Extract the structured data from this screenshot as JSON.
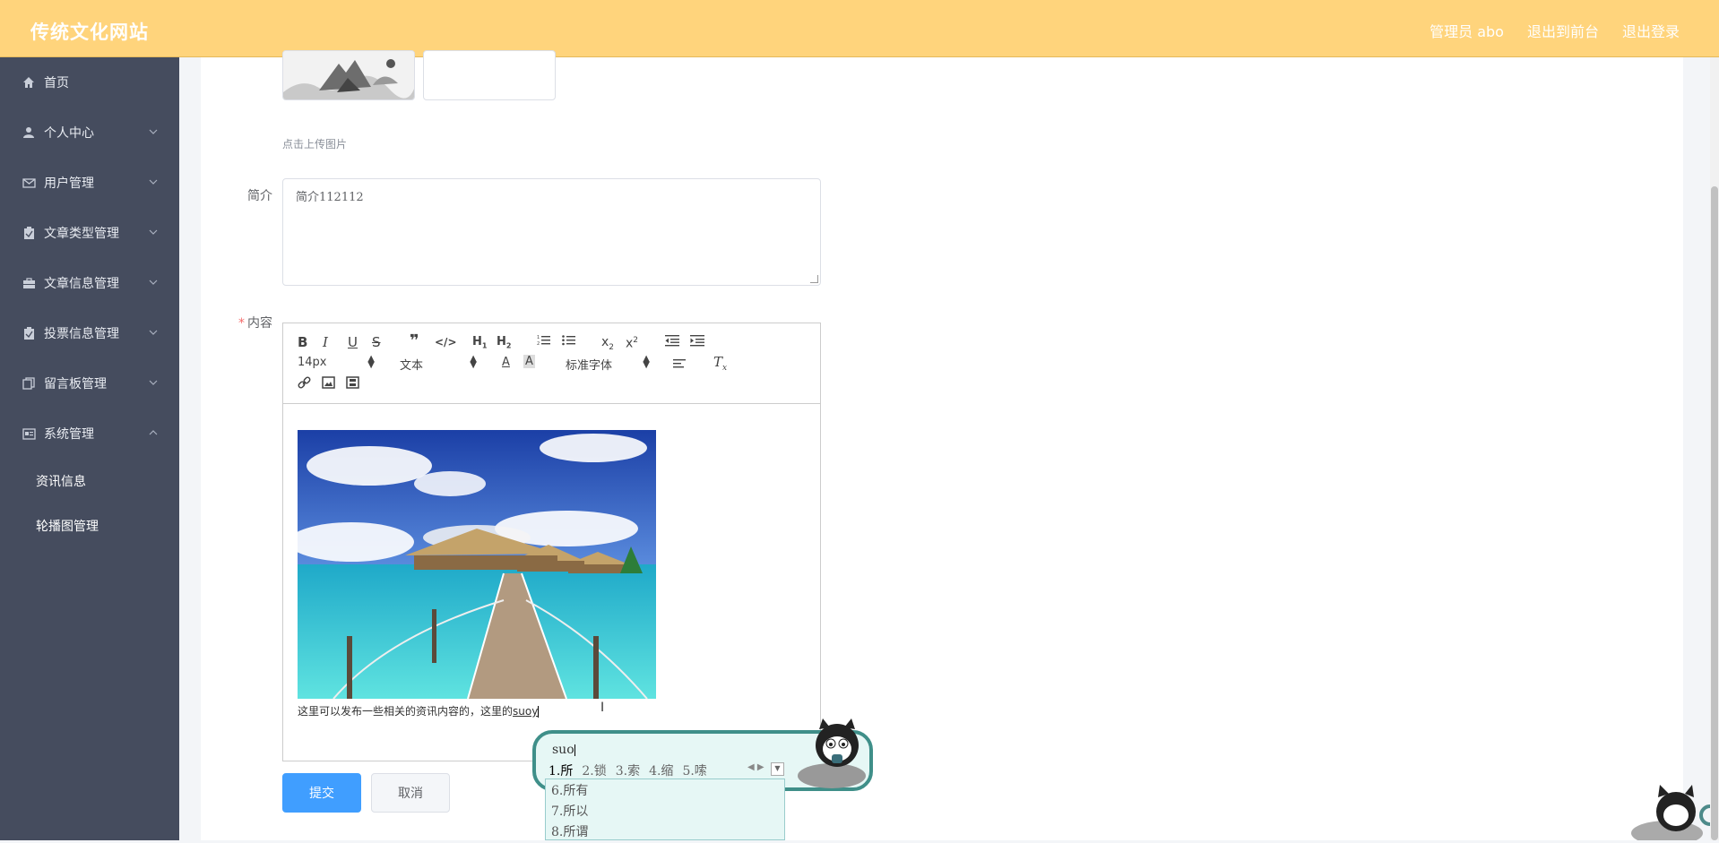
{
  "header": {
    "site_title": "传统文化网站",
    "admin_label": "管理员 abo",
    "to_front_label": "退出到前台",
    "logout_label": "退出登录"
  },
  "sidebar": {
    "items": [
      {
        "label": "首页",
        "icon": "home-icon",
        "expandable": false
      },
      {
        "label": "个人中心",
        "icon": "user-icon",
        "expandable": true
      },
      {
        "label": "用户管理",
        "icon": "mail-icon",
        "expandable": true
      },
      {
        "label": "文章类型管理",
        "icon": "clipboard-icon",
        "expandable": true
      },
      {
        "label": "文章信息管理",
        "icon": "briefcase-icon",
        "expandable": true
      },
      {
        "label": "投票信息管理",
        "icon": "clipboard-check-icon",
        "expandable": true
      },
      {
        "label": "留言板管理",
        "icon": "copy-icon",
        "expandable": true
      },
      {
        "label": "系统管理",
        "icon": "id-card-icon",
        "expandable": true,
        "expanded": true
      }
    ],
    "sub_items": [
      "资讯信息",
      "轮播图管理"
    ]
  },
  "form": {
    "upload_hint": "点击上传图片",
    "intro_label": "简介",
    "intro_value": "简介112112",
    "content_label": "内容",
    "content_required_mark": "*",
    "submit_label": "提交",
    "cancel_label": "取消"
  },
  "editor": {
    "font_size": "14px",
    "block_type": "文本",
    "font_family": "标准字体",
    "content_text": "这里可以发布一些相关的资讯内容的，这里的",
    "typed_text": "suoy"
  },
  "ime": {
    "composition": "suo",
    "candidates": [
      "1.所",
      "2.锁",
      "3.索",
      "4.缩",
      "5.嗦"
    ],
    "expanded": [
      "6.所有",
      "7.所以",
      "8.所谓"
    ]
  },
  "colors": {
    "header_bg": "#ffd47c",
    "sidebar_bg": "#454c5e",
    "primary": "#409eff",
    "required": "#f56c6c",
    "ime_border": "#3f8f89"
  }
}
